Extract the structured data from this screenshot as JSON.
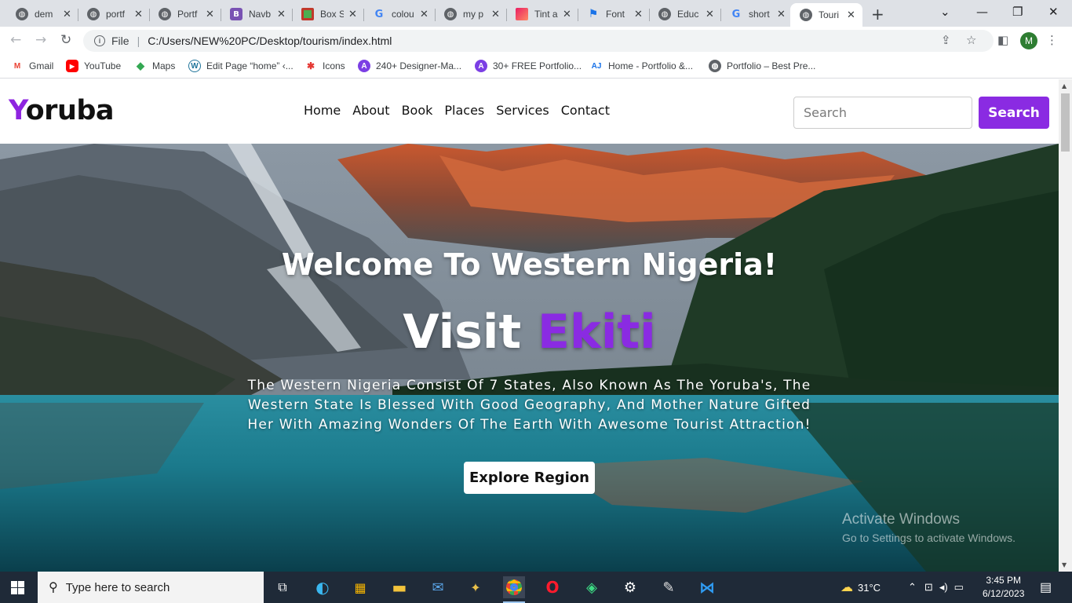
{
  "browser": {
    "tabs": [
      {
        "label": "dem",
        "icon": "globe-icon"
      },
      {
        "label": "portf",
        "icon": "globe-icon"
      },
      {
        "label": "Portf",
        "icon": "globe-icon"
      },
      {
        "label": "Navb",
        "icon": "bootstrap-icon"
      },
      {
        "label": "Box S",
        "icon": "box-shadow-icon"
      },
      {
        "label": "colou",
        "icon": "google-icon"
      },
      {
        "label": "my p",
        "icon": "globe-icon"
      },
      {
        "label": "Tint a",
        "icon": "tint-icon"
      },
      {
        "label": "Font",
        "icon": "flag-icon"
      },
      {
        "label": "Educ",
        "icon": "globe-icon"
      },
      {
        "label": "short",
        "icon": "google-icon"
      },
      {
        "label": "Touri",
        "icon": "globe-icon",
        "active": true
      }
    ],
    "address": {
      "scheme_label": "File",
      "url": "C:/Users/NEW%20PC/Desktop/tourism/index.html"
    },
    "profile_initial": "M",
    "bookmarks": [
      {
        "label": "Gmail",
        "icon": "gmail-icon"
      },
      {
        "label": "YouTube",
        "icon": "youtube-icon"
      },
      {
        "label": "Maps",
        "icon": "maps-icon"
      },
      {
        "label": "Edit Page “home” ‹...",
        "icon": "wordpress-icon"
      },
      {
        "label": "Icons",
        "icon": "icons8-icon"
      },
      {
        "label": "240+ Designer-Ma...",
        "icon": "designer-icon"
      },
      {
        "label": "30+ FREE Portfolio...",
        "icon": "designer-icon"
      },
      {
        "label": "Home - Portfolio &...",
        "icon": "aj-icon"
      },
      {
        "label": "Portfolio – Best Pre...",
        "icon": "globe-icon"
      }
    ]
  },
  "site": {
    "logo_first": "Y",
    "logo_rest": "oruba",
    "nav": [
      "Home",
      "About",
      "Book",
      "Places",
      "Services",
      "Contact"
    ],
    "search_placeholder": "Search",
    "search_button": "Search"
  },
  "hero": {
    "title": "Welcome To Western Nigeria!",
    "visit_prefix": "Visit",
    "visit_highlight": "Ekiti",
    "text": "The Western Nigeria Consist Of 7 States, Also Known As The Yoruba's, The Western State Is Blessed With Good Geography, And Mother Nature Gifted Her With Amazing Wonders Of The Earth With Awesome Tourist Attraction!",
    "button": "Explore Region"
  },
  "watermark": {
    "line1": "Activate Windows",
    "line2": "Go to Settings to activate Windows."
  },
  "taskbar": {
    "search_placeholder": "Type here to search",
    "weather": "31°C",
    "time": "3:45 PM",
    "date": "6/12/2023"
  },
  "colors": {
    "accent": "#8a2be2",
    "taskbar": "#1f2a38"
  }
}
